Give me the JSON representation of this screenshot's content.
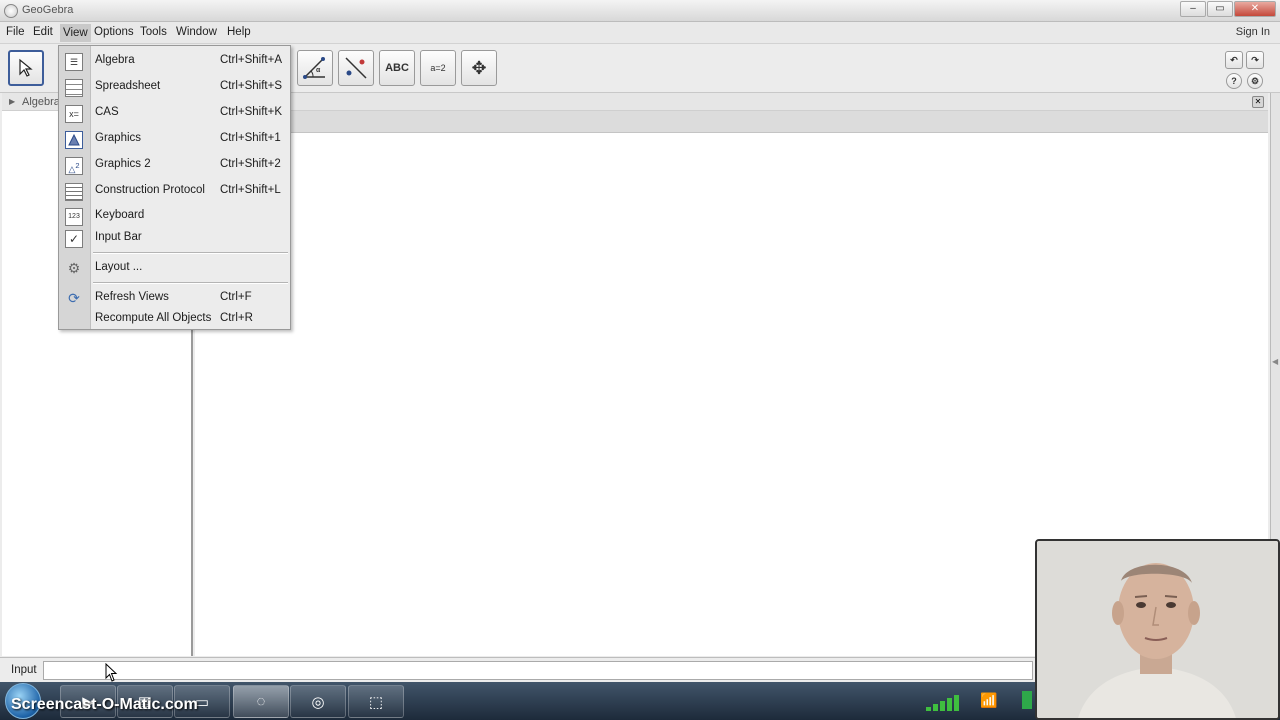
{
  "app": {
    "title": "GeoGebra",
    "sign_in": "Sign In"
  },
  "menubar": {
    "items": [
      "File",
      "Edit",
      "View",
      "Options",
      "Tools",
      "Window",
      "Help"
    ],
    "active": "View"
  },
  "view_menu": {
    "items": [
      {
        "label": "Algebra",
        "shortcut": "Ctrl+Shift+A",
        "icon": "algebra-icon"
      },
      {
        "label": "Spreadsheet",
        "shortcut": "Ctrl+Shift+S",
        "icon": "spreadsheet-icon"
      },
      {
        "label": "CAS",
        "shortcut": "Ctrl+Shift+K",
        "icon": "cas-icon",
        "glyph": "x="
      },
      {
        "label": "Graphics",
        "shortcut": "Ctrl+Shift+1",
        "icon": "graphics-icon"
      },
      {
        "label": "Graphics 2",
        "shortcut": "Ctrl+Shift+2",
        "icon": "graphics2-icon",
        "glyph": "2"
      },
      {
        "label": "Construction Protocol",
        "shortcut": "Ctrl+Shift+L",
        "icon": "construction-protocol-icon"
      },
      {
        "label": "Keyboard",
        "shortcut": "",
        "icon": "keyboard-icon",
        "glyph": "123"
      },
      {
        "label": "Input Bar",
        "shortcut": "",
        "icon": "checkmark-icon",
        "glyph": "✓",
        "checked": true
      },
      {
        "label": "Layout ...",
        "shortcut": "",
        "icon": "gear-icon",
        "glyph": "⚙"
      },
      {
        "label": "Refresh Views",
        "shortcut": "Ctrl+F",
        "icon": "refresh-icon",
        "glyph": "⟳"
      },
      {
        "label": "Recompute All Objects",
        "shortcut": "Ctrl+R",
        "icon": "",
        "glyph": ""
      }
    ]
  },
  "toolbar": {
    "move_tool": "move-arrow-icon",
    "tools": [
      {
        "icon": "angle-tool-icon",
        "label": ""
      },
      {
        "icon": "reflect-tool-icon",
        "label": ""
      },
      {
        "icon": "text-tool-icon",
        "label": "ABC"
      },
      {
        "icon": "slider-tool-icon",
        "label": "a=2"
      },
      {
        "icon": "move-graphics-view-icon",
        "label": "✥"
      }
    ]
  },
  "algebra_view": {
    "header": "Algebra"
  },
  "input_bar": {
    "label": "Input",
    "value": ""
  },
  "overlay": {
    "watermark": "Screencast-O-Matic.com"
  },
  "colors": {
    "selected_border": "#3d5d9a",
    "taskbar": "#1d2a3a",
    "tray_signal": "#3fbf3f"
  }
}
